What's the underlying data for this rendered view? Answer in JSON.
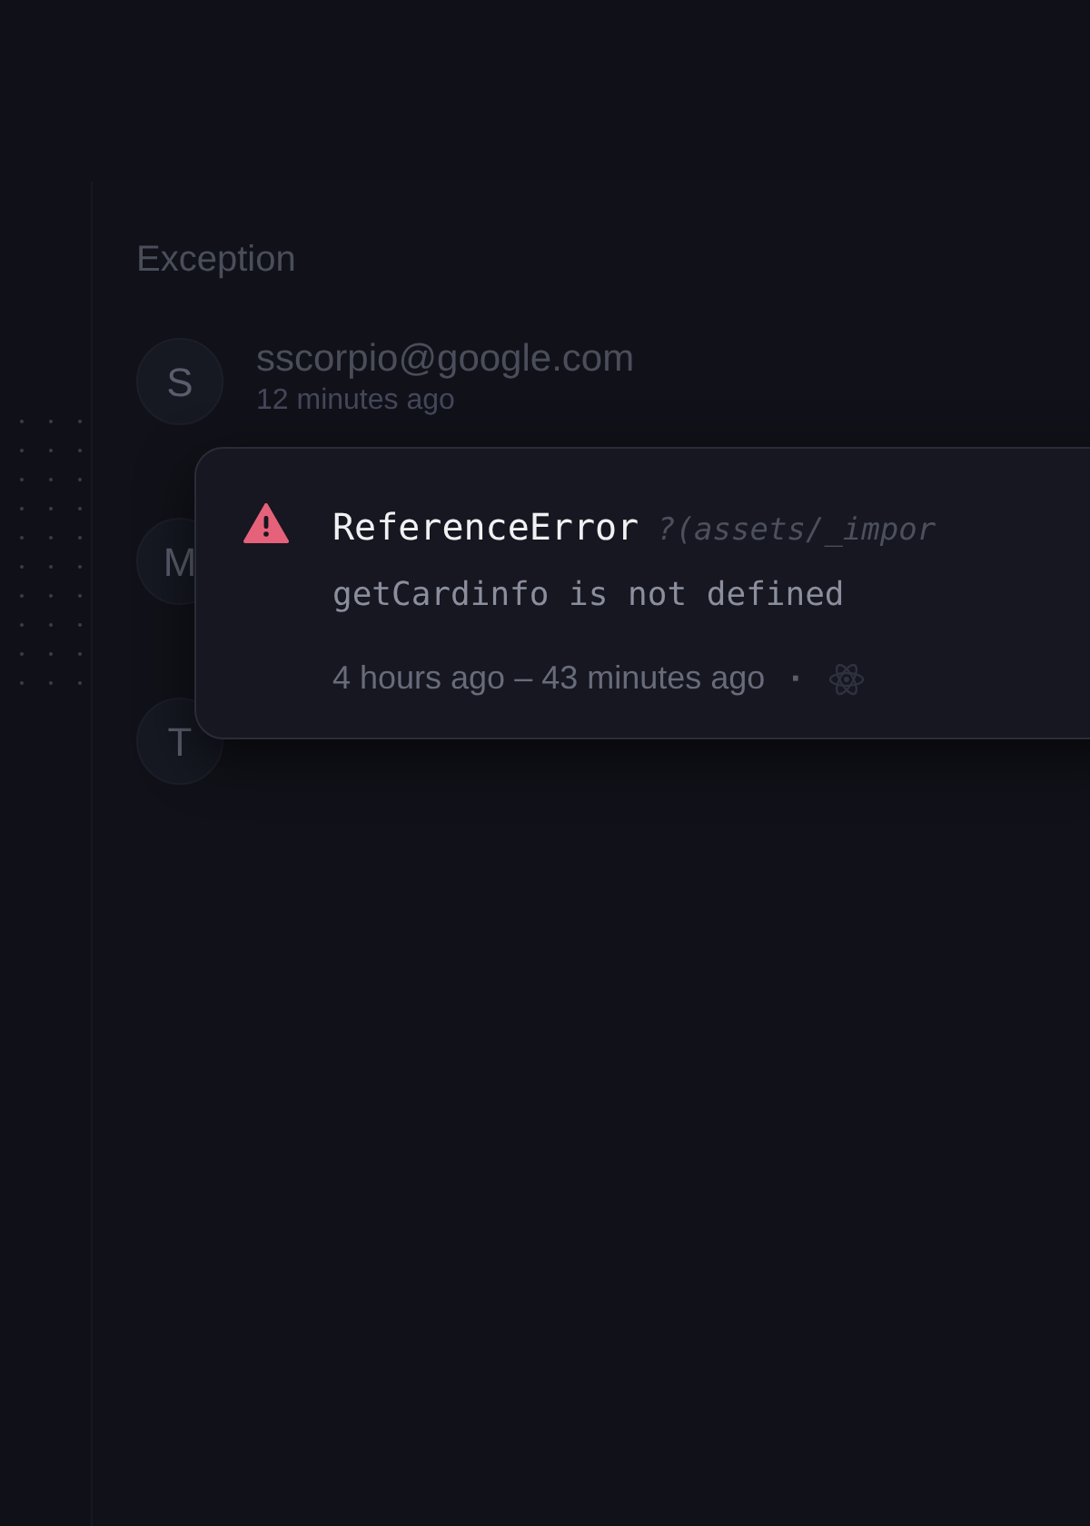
{
  "panel": {
    "title": "Exception",
    "rows": [
      {
        "avatar": "S",
        "title": "sscorpio@google.com",
        "subtitle": "12 minutes ago"
      },
      {
        "avatar": "M"
      },
      {
        "avatar": "T"
      }
    ]
  },
  "error_card": {
    "name": "ReferenceError",
    "location": "?(assets/_impor",
    "message": "getCardinfo is not defined",
    "time": "4 hours ago – 43 minutes ago",
    "separator": "·"
  }
}
